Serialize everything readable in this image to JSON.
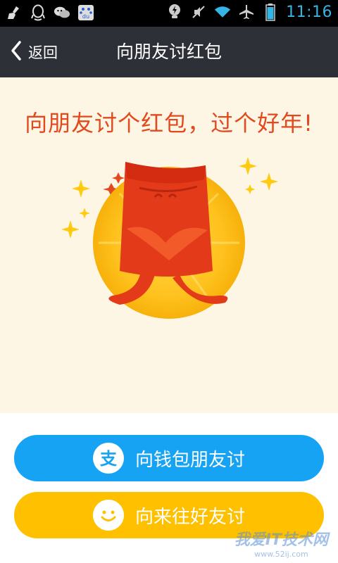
{
  "status_bar": {
    "time": "11:16",
    "left_icons": [
      "broom-icon",
      "qq-icon",
      "wechat-icon",
      "baidu-icon"
    ],
    "right_icons": [
      "bulb-icon",
      "mute-icon",
      "wifi-icon",
      "airplane-icon",
      "battery-icon"
    ],
    "baidu_label": "du"
  },
  "header": {
    "back_label": "返回",
    "title": "向朋友讨红包"
  },
  "main": {
    "headline": "向朋友讨个红包，过个好年!"
  },
  "actions": {
    "wallet_label": "向钱包朋友讨",
    "laiwang_label": "向来往好友讨",
    "alipay_glyph": "支"
  },
  "watermark": {
    "text": "我爱IT技术网",
    "sub": "www.52ij.com"
  },
  "colors": {
    "title_bar": "#2e3038",
    "headline": "#e2491e",
    "blue_button": "#16a3f3",
    "yellow_button": "#ffc000",
    "content_bg": "#fdf6e4"
  }
}
